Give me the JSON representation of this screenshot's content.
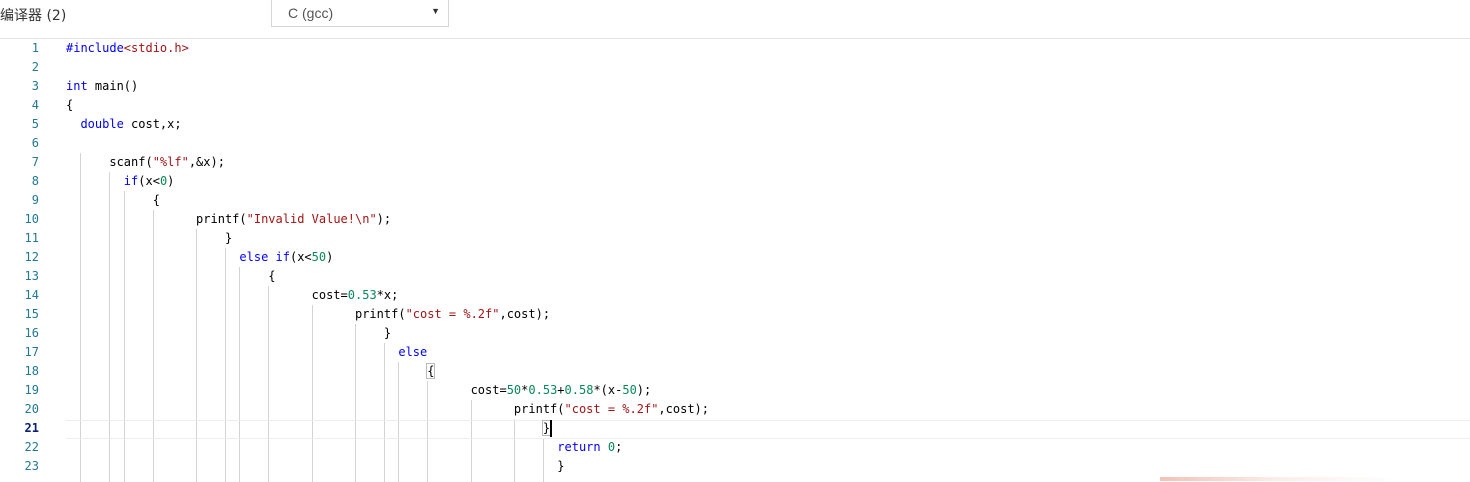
{
  "header": {
    "compiler_label": "编译器 (2)",
    "language_select": {
      "selected": "C (gcc)",
      "arrow": "▼"
    }
  },
  "editor": {
    "current_line": 21,
    "lines": [
      {
        "n": "1",
        "tokens": [
          [
            "kw",
            "#include"
          ],
          [
            "str",
            "<stdio.h>"
          ]
        ]
      },
      {
        "n": "2",
        "tokens": []
      },
      {
        "n": "3",
        "tokens": [
          [
            "kw",
            "int"
          ],
          [
            "",
            " main()"
          ]
        ]
      },
      {
        "n": "4",
        "tokens": [
          [
            "",
            "{"
          ]
        ]
      },
      {
        "n": "5",
        "tokens": [
          [
            "",
            "  "
          ],
          [
            "kw",
            "double"
          ],
          [
            "",
            " cost,x;"
          ]
        ]
      },
      {
        "n": "6",
        "tokens": []
      },
      {
        "n": "7",
        "tokens": [
          [
            "",
            "      scanf("
          ],
          [
            "str",
            "\"%lf\""
          ],
          [
            "",
            ",&x);"
          ]
        ]
      },
      {
        "n": "8",
        "tokens": [
          [
            "",
            "        "
          ],
          [
            "kw",
            "if"
          ],
          [
            "",
            "(x<"
          ],
          [
            "num",
            "0"
          ],
          [
            "",
            ")"
          ]
        ]
      },
      {
        "n": "9",
        "tokens": [
          [
            "",
            "            {"
          ]
        ]
      },
      {
        "n": "10",
        "tokens": [
          [
            "",
            "                  printf("
          ],
          [
            "str",
            "\"Invalid Value!\\n\""
          ],
          [
            "",
            ");"
          ]
        ]
      },
      {
        "n": "11",
        "tokens": [
          [
            "",
            "                      }"
          ]
        ]
      },
      {
        "n": "12",
        "tokens": [
          [
            "",
            "                        "
          ],
          [
            "kw",
            "else"
          ],
          [
            "",
            " "
          ],
          [
            "kw",
            "if"
          ],
          [
            "",
            "(x<"
          ],
          [
            "num",
            "50"
          ],
          [
            "",
            ")"
          ]
        ]
      },
      {
        "n": "13",
        "tokens": [
          [
            "",
            "                            {"
          ]
        ]
      },
      {
        "n": "14",
        "tokens": [
          [
            "",
            "                                  cost="
          ],
          [
            "num",
            "0.53"
          ],
          [
            "",
            "*x;"
          ]
        ]
      },
      {
        "n": "15",
        "tokens": [
          [
            "",
            "                                        printf("
          ],
          [
            "str",
            "\"cost = %.2f\""
          ],
          [
            "",
            ",cost);"
          ]
        ]
      },
      {
        "n": "16",
        "tokens": [
          [
            "",
            "                                            }"
          ]
        ]
      },
      {
        "n": "17",
        "tokens": [
          [
            "",
            "                                              "
          ],
          [
            "kw",
            "else"
          ]
        ]
      },
      {
        "n": "18",
        "tokens": [
          [
            "",
            "                                                  "
          ],
          [
            "box",
            "{"
          ]
        ]
      },
      {
        "n": "19",
        "tokens": [
          [
            "",
            "                                                        cost="
          ],
          [
            "num",
            "50"
          ],
          [
            "",
            "*"
          ],
          [
            "num",
            "0.53"
          ],
          [
            "",
            "+"
          ],
          [
            "num",
            "0.58"
          ],
          [
            "",
            "*(x-"
          ],
          [
            "num",
            "50"
          ],
          [
            "",
            ");"
          ]
        ]
      },
      {
        "n": "20",
        "tokens": [
          [
            "",
            "                                                              printf("
          ],
          [
            "str",
            "\"cost = %.2f\""
          ],
          [
            "",
            ",cost);"
          ]
        ]
      },
      {
        "n": "21",
        "tokens": [
          [
            "",
            "                                                                  "
          ],
          [
            "box",
            "}"
          ]
        ]
      },
      {
        "n": "22",
        "tokens": [
          [
            "",
            "                                                                    "
          ],
          [
            "kw",
            "return"
          ],
          [
            "",
            " "
          ],
          [
            "num",
            "0"
          ],
          [
            "",
            ";"
          ]
        ]
      },
      {
        "n": "23",
        "tokens": [
          [
            "",
            "                                                                    }"
          ]
        ]
      }
    ]
  }
}
